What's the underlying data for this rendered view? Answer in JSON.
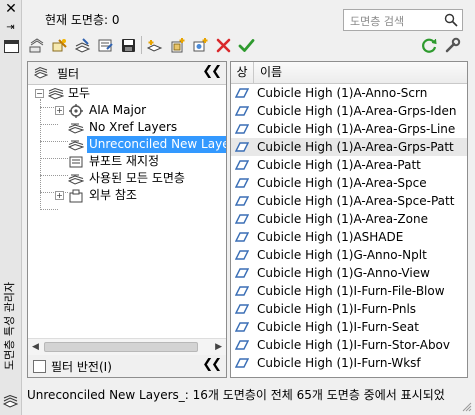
{
  "window": {
    "title": "도면층 특성 관리자"
  },
  "header": {
    "current_layer": "현재 도면층: 0",
    "search_placeholder": "도면층 검색"
  },
  "toolbar": {
    "left_icons": [
      "new-property-filter-icon",
      "new-group-filter-icon",
      "layer-states-manager-icon",
      "new-layer-vp-icon",
      "save-icon",
      "new-layer-icon",
      "new-layer-frozen-vp-icon",
      "new-layer-vp-frozen-icon",
      "delete-layer-icon",
      "set-current-icon"
    ],
    "right_icons": [
      "refresh-icon",
      "settings-icon"
    ]
  },
  "filters": {
    "header_label": "필터",
    "tree": [
      {
        "label": "모두",
        "level": 0,
        "expander": "-",
        "icon": "filter-all-icon"
      },
      {
        "label": "AIA Major",
        "level": 1,
        "expander": "+",
        "icon": "group-filter-icon"
      },
      {
        "label": "No Xref Layers",
        "level": 1,
        "expander": "",
        "icon": "property-filter-icon"
      },
      {
        "label": "Unreconciled New Layers",
        "level": 1,
        "expander": "",
        "icon": "property-filter-icon",
        "selected": true
      },
      {
        "label": "뷰포트 재지정",
        "level": 1,
        "expander": "",
        "icon": "viewport-override-icon"
      },
      {
        "label": "사용된 모든 도면층",
        "level": 1,
        "expander": "",
        "icon": "property-filter-icon"
      },
      {
        "label": "외부 참조",
        "level": 1,
        "expander": "+",
        "icon": "xref-icon"
      }
    ],
    "invert_label": "필터 반전(I)",
    "invert_checked": false
  },
  "layers": {
    "columns": [
      "상",
      "이름"
    ],
    "rows": [
      {
        "name": "Cubicle High (1)A-Anno-Scrn"
      },
      {
        "name": "Cubicle High (1)A-Area-Grps-Iden"
      },
      {
        "name": "Cubicle High (1)A-Area-Grps-Line"
      },
      {
        "name": "Cubicle High (1)A-Area-Grps-Patt",
        "highlighted": true
      },
      {
        "name": "Cubicle High (1)A-Area-Patt"
      },
      {
        "name": "Cubicle High (1)A-Area-Spce"
      },
      {
        "name": "Cubicle High (1)A-Area-Spce-Patt"
      },
      {
        "name": "Cubicle High (1)A-Area-Zone"
      },
      {
        "name": "Cubicle High (1)ASHADE"
      },
      {
        "name": "Cubicle High (1)G-Anno-Nplt"
      },
      {
        "name": "Cubicle High (1)G-Anno-View"
      },
      {
        "name": "Cubicle High (1)I-Furn-File-Blow"
      },
      {
        "name": "Cubicle High (1)I-Furn-Pnls"
      },
      {
        "name": "Cubicle High (1)I-Furn-Seat"
      },
      {
        "name": "Cubicle High (1)I-Furn-Stor-Abov"
      },
      {
        "name": "Cubicle High (1)I-Furn-Wksf"
      }
    ]
  },
  "status": {
    "text": "Unreconciled  New  Layers_: 16개 도면층이 전체 65개 도면층 중에서 표시되었"
  },
  "colors": {
    "selection": "#3399ff",
    "status_icon": "#3b6fb6",
    "delete": "#d9282b",
    "check": "#2e9a2e"
  }
}
